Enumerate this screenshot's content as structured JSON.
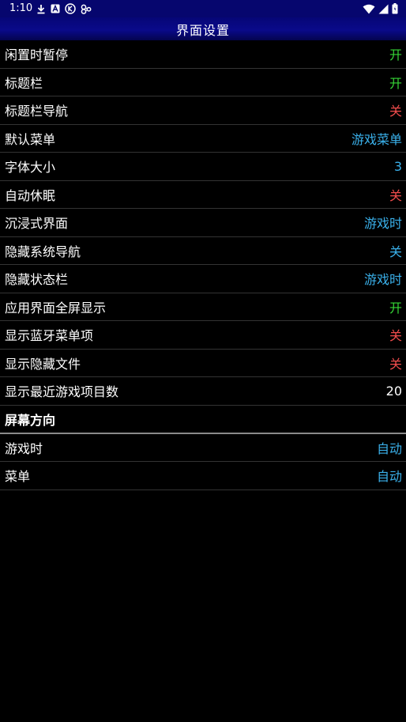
{
  "status_bar": {
    "time": "1:10",
    "left_icons": [
      "download-icon",
      "a-box-icon",
      "k-circle-icon",
      "link-icon"
    ],
    "right_icons": [
      "wifi-icon",
      "signal-icon",
      "battery-icon"
    ]
  },
  "header": {
    "title": "界面设置"
  },
  "colors": {
    "on": "#35d435",
    "off": "#f04c4c",
    "info": "#3ab0ea",
    "plain": "#ffffff"
  },
  "settings": [
    {
      "label": "闲置时暂停",
      "value": "开",
      "kind": "on"
    },
    {
      "label": "标题栏",
      "value": "开",
      "kind": "on"
    },
    {
      "label": "标题栏导航",
      "value": "关",
      "kind": "off"
    },
    {
      "label": "默认菜单",
      "value": "游戏菜单",
      "kind": "info"
    },
    {
      "label": "字体大小",
      "value": "3",
      "kind": "info"
    },
    {
      "label": "自动休眠",
      "value": "关",
      "kind": "off"
    },
    {
      "label": "沉浸式界面",
      "value": "游戏时",
      "kind": "info"
    },
    {
      "label": "隐藏系统导航",
      "value": "关",
      "kind": "info"
    },
    {
      "label": "隐藏状态栏",
      "value": "游戏时",
      "kind": "info"
    },
    {
      "label": "应用界面全屏显示",
      "value": "开",
      "kind": "on"
    },
    {
      "label": "显示蓝牙菜单项",
      "value": "关",
      "kind": "off"
    },
    {
      "label": "显示隐藏文件",
      "value": "关",
      "kind": "off"
    },
    {
      "label": "显示最近游戏项目数",
      "value": "20",
      "kind": "plain"
    }
  ],
  "orientation_section": {
    "title": "屏幕方向",
    "items": [
      {
        "label": "游戏时",
        "value": "自动",
        "kind": "info"
      },
      {
        "label": "菜单",
        "value": "自动",
        "kind": "info"
      }
    ]
  }
}
